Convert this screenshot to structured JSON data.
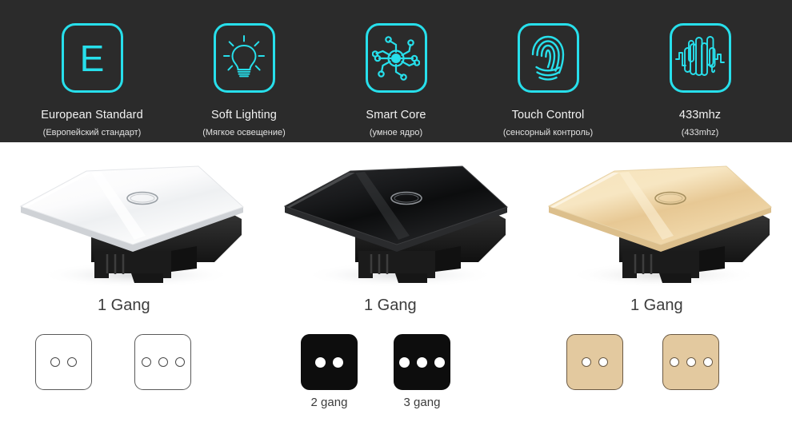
{
  "features": [
    {
      "icon": "letter-e-icon",
      "title": "European Standard",
      "subtitle": "(Европейский стандарт)",
      "glyph": "E"
    },
    {
      "icon": "lightbulb-icon",
      "title": "Soft Lighting",
      "subtitle": "(Мягкое освещение)"
    },
    {
      "icon": "smart-core-network-icon",
      "title": "Smart Core",
      "subtitle": "(умное ядро)"
    },
    {
      "icon": "fingerprint-icon",
      "title": "Touch Control",
      "subtitle": "(сенсорный контроль)"
    },
    {
      "icon": "waveform-signal-icon",
      "title": "433mhz",
      "subtitle": "(433mhz)"
    }
  ],
  "colors": {
    "accent_cyan": "#27dfeb",
    "bar_background": "#2b2b2b",
    "bar_text": "#f2f2f2",
    "caption_text": "#3c3c3c",
    "gold_panel": "#e3c99f",
    "black_panel": "#0d0d0d"
  },
  "products": [
    {
      "variant": "white",
      "gang_caption": "1 Gang",
      "panels": [
        {
          "gang_count": 2,
          "caption": ""
        },
        {
          "gang_count": 3,
          "caption": ""
        }
      ]
    },
    {
      "variant": "black",
      "gang_caption": "1 Gang",
      "panels": [
        {
          "gang_count": 2,
          "caption": "2 gang"
        },
        {
          "gang_count": 3,
          "caption": "3 gang"
        }
      ]
    },
    {
      "variant": "gold",
      "gang_caption": "1 Gang",
      "panels": [
        {
          "gang_count": 2,
          "caption": ""
        },
        {
          "gang_count": 3,
          "caption": ""
        }
      ]
    }
  ]
}
